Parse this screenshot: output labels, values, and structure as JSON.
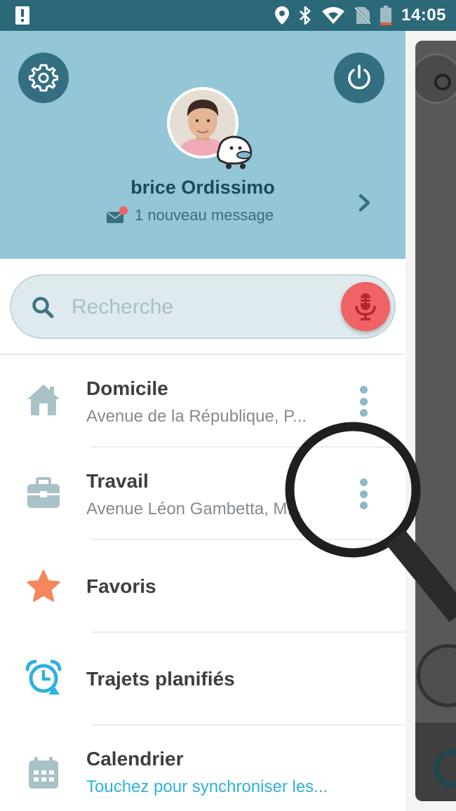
{
  "status_bar": {
    "time": "14:05",
    "icons": [
      "alert-icon",
      "location-icon",
      "bluetooth-icon",
      "wifi-icon",
      "no-sim-icon",
      "battery-icon"
    ]
  },
  "profile": {
    "username": "brice Ordissimo",
    "message": "1 nouveau message",
    "settings_icon": "gear-icon",
    "power_icon": "power-icon"
  },
  "search": {
    "placeholder": "Recherche"
  },
  "menu": {
    "items": [
      {
        "title": "Domicile",
        "subtitle": "Avenue de la République, P...",
        "icon": "home-icon"
      },
      {
        "title": "Travail",
        "subtitle": "Avenue Léon Gambetta, M...",
        "icon": "briefcase-icon"
      },
      {
        "title": "Favoris",
        "subtitle": "",
        "icon": "star-icon"
      },
      {
        "title": "Trajets planifiés",
        "subtitle": "",
        "icon": "alarm-clock-icon"
      },
      {
        "title": "Calendrier",
        "subtitle": "Touchez pour synchroniser les...",
        "icon": "calendar-icon"
      }
    ]
  },
  "colors": {
    "status_bar": "#2c6978",
    "header_bg": "#93c6d6",
    "header_button": "#336f80",
    "mic_button": "#f06264",
    "link_text": "#2fb0e0",
    "star": "#f5875c"
  }
}
